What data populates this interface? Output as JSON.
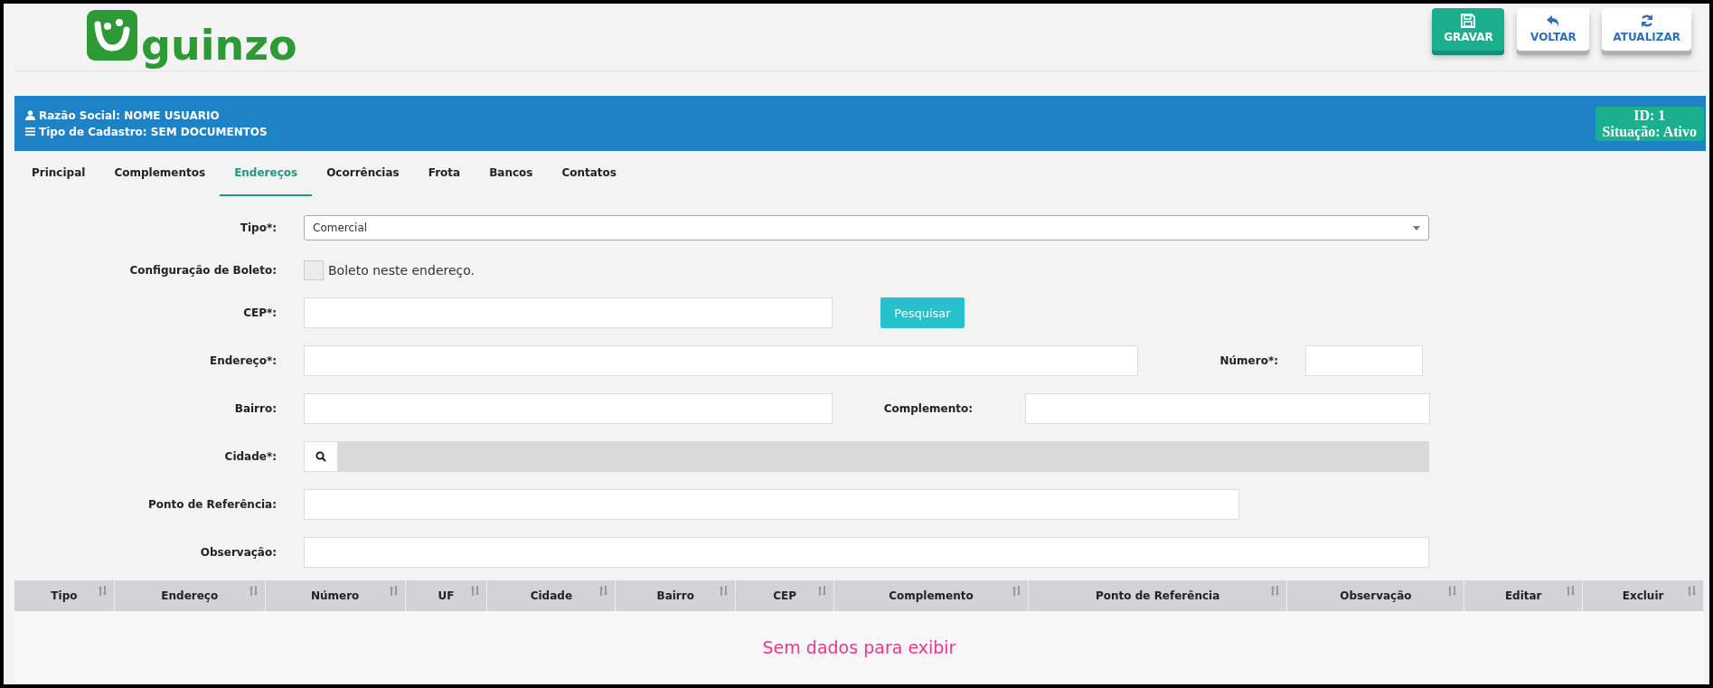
{
  "header": {
    "logo_text": "guinzo",
    "buttons": [
      {
        "label": "GRAVAR",
        "kind": "primary"
      },
      {
        "label": "VOLTAR",
        "kind": "default"
      },
      {
        "label": "ATUALIZAR",
        "kind": "default"
      }
    ]
  },
  "info_bar": {
    "razao_social": "Razão Social: NOME USUARIO",
    "tipo_cadastro": "Tipo de Cadastro: SEM DOCUMENTOS",
    "id": "ID: 1",
    "situacao": "Situação: Ativo"
  },
  "tabs": [
    {
      "label": "Principal",
      "selected": false
    },
    {
      "label": "Complementos",
      "selected": false
    },
    {
      "label": "Endereços",
      "selected": true
    },
    {
      "label": "Ocorrências",
      "selected": false
    },
    {
      "label": "Frota",
      "selected": false
    },
    {
      "label": "Bancos",
      "selected": false
    },
    {
      "label": "Contatos",
      "selected": false
    }
  ],
  "form": {
    "tipo": {
      "label": "Tipo*:",
      "value": "Comercial"
    },
    "boleto": {
      "label": "Configuração de Boleto:",
      "checkbox_label": "Boleto neste endereço.",
      "checked": false
    },
    "cep": {
      "label": "CEP*:",
      "button": "Pesquisar"
    },
    "endereco": {
      "label": "Endereço*:"
    },
    "numero": {
      "label": "Número*:"
    },
    "bairro": {
      "label": "Bairro:"
    },
    "complemento": {
      "label": "Complemento:"
    },
    "cidade": {
      "label": "Cidade*:"
    },
    "ponto_referencia": {
      "label": "Ponto de Referência:"
    },
    "observacao": {
      "label": "Observação:"
    }
  },
  "table": {
    "columns": [
      "Tipo",
      "Endereço",
      "Número",
      "UF",
      "Cidade",
      "Bairro",
      "CEP",
      "Complemento",
      "Ponto de Referência",
      "Observação",
      "Editar",
      "Excluir"
    ],
    "empty_message": "Sem dados para exibir"
  }
}
